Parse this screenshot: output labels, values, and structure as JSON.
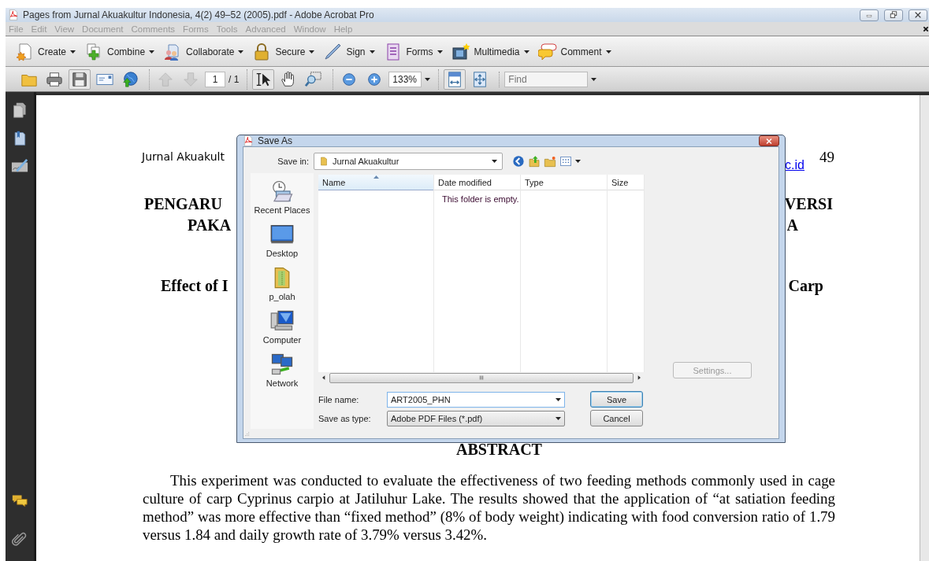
{
  "window": {
    "title": "Pages from Jurnal Akuakultur Indonesia, 4(2) 49–52 (2005).pdf - Adobe Acrobat Pro"
  },
  "menu": [
    {
      "label": "File",
      "disabled": true
    },
    {
      "label": "Edit",
      "disabled": true
    },
    {
      "label": "View",
      "disabled": true
    },
    {
      "label": "Document",
      "disabled": true
    },
    {
      "label": "Comments",
      "disabled": true
    },
    {
      "label": "Forms",
      "disabled": true
    },
    {
      "label": "Tools",
      "disabled": true
    },
    {
      "label": "Advanced",
      "disabled": true
    },
    {
      "label": "Window",
      "disabled": true
    },
    {
      "label": "Help",
      "disabled": true
    }
  ],
  "task_toolbar": [
    {
      "label": "Create"
    },
    {
      "label": "Combine"
    },
    {
      "label": "Collaborate"
    },
    {
      "label": "Secure"
    },
    {
      "label": "Sign"
    },
    {
      "label": "Forms"
    },
    {
      "label": "Multimedia"
    },
    {
      "label": "Comment"
    }
  ],
  "nav_buttons": [
    {
      "pressed": false,
      "disabled": false
    },
    {
      "pressed": false,
      "disabled": false
    },
    {
      "pressed": true,
      "disabled": false
    },
    {
      "pressed": false,
      "disabled": false
    },
    {
      "pressed": false,
      "disabled": false
    },
    {
      "pressed": false,
      "disabled": true
    },
    {
      "pressed": false,
      "disabled": true
    },
    {
      "pressed": true,
      "disabled": false
    },
    {
      "pressed": false,
      "disabled": false
    },
    {
      "pressed": false,
      "disabled": false
    },
    {
      "pressed": false,
      "disabled": false
    },
    {
      "pressed": false,
      "disabled": false
    },
    {
      "pressed": true,
      "disabled": false
    },
    {
      "pressed": false,
      "disabled": false
    }
  ],
  "page_field": {
    "value": "1"
  },
  "page_count": "/ 1",
  "zoom_field": {
    "value": "133%"
  },
  "find_field": {
    "placeholder": "Find"
  },
  "document": {
    "header_left": "Jurnal Akuakult",
    "header_link": "c.id",
    "page_number": "49",
    "title_lines": [
      {
        "left": "PENGARU",
        "right": "VERSI"
      },
      {
        "left": "PAKA",
        "right": "A"
      }
    ],
    "subtitle": {
      "left": "Effect of I",
      "right": "Carp"
    },
    "abstract_heading": "ABSTRACT",
    "abstract": "This experiment was conducted to evaluate the effectiveness of two feeding methods commonly used in cage culture of carp Cyprinus carpio at Jatiluhur Lake. The results showed that the application of “at satiation feeding method” was more effective than “fixed method” (8% of body weight) indicating with food conversion ratio of 1.79 versus 1.84 and daily growth rate of 3.79% versus 3.42%."
  },
  "save_dialog": {
    "title": "Save As",
    "save_in_label": "Save in:",
    "save_in": {
      "value": "Jurnal Akuakultur"
    },
    "places": [
      {
        "label": "Recent Places"
      },
      {
        "label": "Desktop"
      },
      {
        "label": "p_olah"
      },
      {
        "label": "Computer"
      },
      {
        "label": "Network"
      }
    ],
    "columns": [
      {
        "label": "Name",
        "sorted": true
      },
      {
        "label": "Date modified",
        "sorted": false
      },
      {
        "label": "Type",
        "sorted": false
      },
      {
        "label": "Size",
        "sorted": false
      }
    ],
    "empty_message": "This folder is empty.",
    "file_name_label": "File name:",
    "file_name": {
      "value": "ART2005_PHN"
    },
    "type_label": "Save as type:",
    "type": {
      "value": "Adobe PDF Files (*.pdf)"
    },
    "buttons": [
      {
        "label": "Save",
        "default": true
      },
      {
        "label": "Cancel",
        "default": false
      }
    ],
    "settings_button": {
      "label": "Settings...",
      "disabled": true
    }
  }
}
